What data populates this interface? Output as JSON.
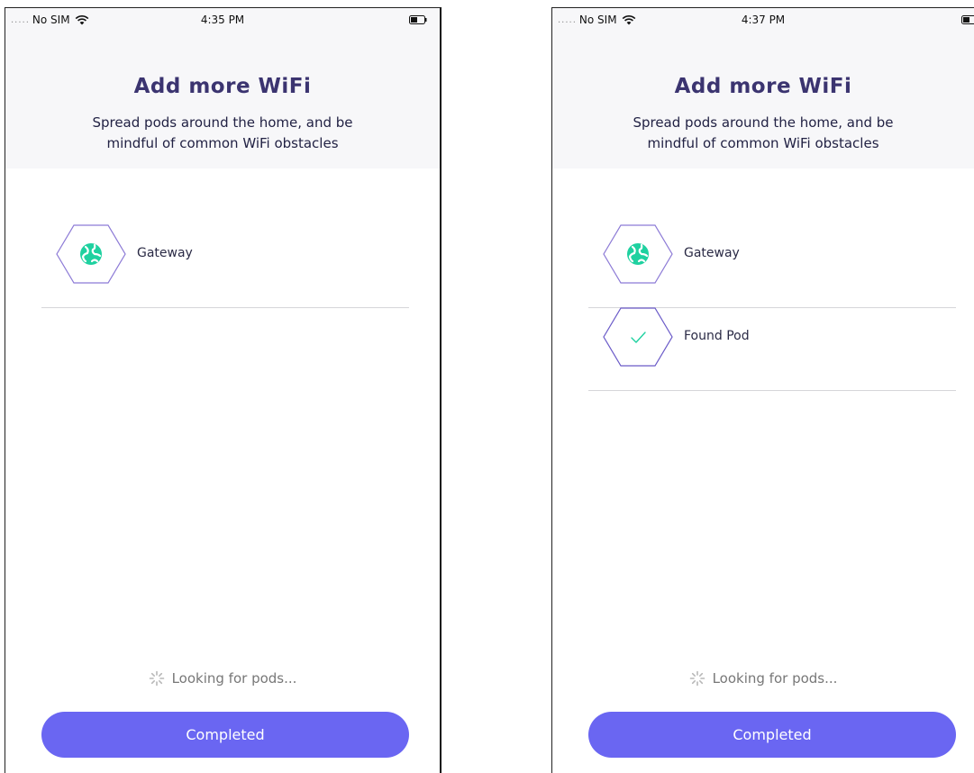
{
  "screens": [
    {
      "status_bar": {
        "signal": ".....",
        "carrier": "No SIM",
        "time": "4:35 PM"
      },
      "header": {
        "title": "Add more WiFi",
        "subtitle_line1": "Spread pods around the home, and be",
        "subtitle_line2": "mindful of common WiFi obstacles"
      },
      "devices": [
        {
          "label": "Gateway",
          "icon": "globe-icon"
        }
      ],
      "status_text": "Looking for pods...",
      "button_label": "Completed"
    },
    {
      "status_bar": {
        "signal": ".....",
        "carrier": "No SIM",
        "time": "4:37 PM"
      },
      "header": {
        "title": "Add more WiFi",
        "subtitle_line1": "Spread pods around the home, and be",
        "subtitle_line2": "mindful of common WiFi obstacles"
      },
      "devices": [
        {
          "label": "Gateway",
          "icon": "globe-icon"
        },
        {
          "label": "Found Pod",
          "icon": "checkmark-icon"
        }
      ],
      "status_text": "Looking for pods...",
      "button_label": "Completed"
    }
  ],
  "colors": {
    "accent": "#6a66f2",
    "title": "#3b3470",
    "header_bg": "#f7f7f9",
    "globe": "#1fd1a0",
    "hex_outline": "#8c7ad6"
  }
}
